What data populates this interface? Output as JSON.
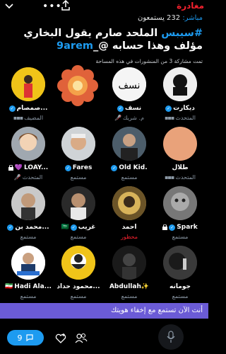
{
  "topbar": {
    "leave_label": "مغادرة"
  },
  "space": {
    "live_label": "مباشر:",
    "listener_count": "232 يستمعون",
    "title_hashtag": "#سيبس",
    "title_text": " الملحد صارم يقول البخاري مؤلف وهذا حسابه @_",
    "title_handle": "9arem",
    "shared_posts": "تمت مشاركة 3 من المنشورات في هذه المساحة"
  },
  "participants": [
    {
      "name": "ديكارت",
      "role": "المتحدث",
      "verified": true,
      "role_icon": "dots"
    },
    {
      "name": "نسف",
      "role": "م. شريك",
      "verified": true,
      "role_icon": "muted-mic"
    },
    {
      "name": "",
      "role": "",
      "verified": false,
      "role_icon": ""
    },
    {
      "name": "صمصام...",
      "role": "المضيف",
      "verified": true,
      "role_icon": "dots"
    },
    {
      "name": "طلال",
      "role": "المتحدث",
      "verified": false,
      "role_icon": "dots"
    },
    {
      "name": "Old Kid.",
      "role": "مستمع",
      "verified": true,
      "role_icon": ""
    },
    {
      "name": "Fares",
      "role": "مستمع",
      "verified": true,
      "role_icon": ""
    },
    {
      "name": "LOAY...",
      "role": "المتحدث",
      "verified": false,
      "role_icon": "muted-mic",
      "prefix": "💜",
      "lock": true
    },
    {
      "name": "Spark",
      "role": "مستمع",
      "verified": true,
      "role_icon": "",
      "lock": true
    },
    {
      "name": "أحمد",
      "role": "محظور",
      "verified": false,
      "role_icon": ""
    },
    {
      "name": "غريب",
      "role": "مستمع",
      "verified": true,
      "role_icon": "",
      "flag": "🇸🇦"
    },
    {
      "name": "محمد بن...",
      "role": "مستمع",
      "verified": true,
      "role_icon": ""
    },
    {
      "name": "جومانه",
      "role": "مستمع",
      "verified": false,
      "role_icon": ""
    },
    {
      "name": "Abdullah✨",
      "role": "مستمع",
      "verified": false,
      "role_icon": ""
    },
    {
      "name": "محمود حداد...",
      "role": "مستمع",
      "verified": false,
      "role_icon": ""
    },
    {
      "name": "Hadi Ala...",
      "role": "مستمع",
      "verified": false,
      "role_icon": "",
      "flag": "🇮🇷"
    }
  ],
  "banner": {
    "text": "أنت الآن تستمع مع إخفاء هويتك"
  },
  "bottombar": {
    "reply_count": "9"
  },
  "colors": {
    "accent": "#1d9bf0",
    "danger": "#f4212e",
    "banner": "#6b5bd6"
  }
}
